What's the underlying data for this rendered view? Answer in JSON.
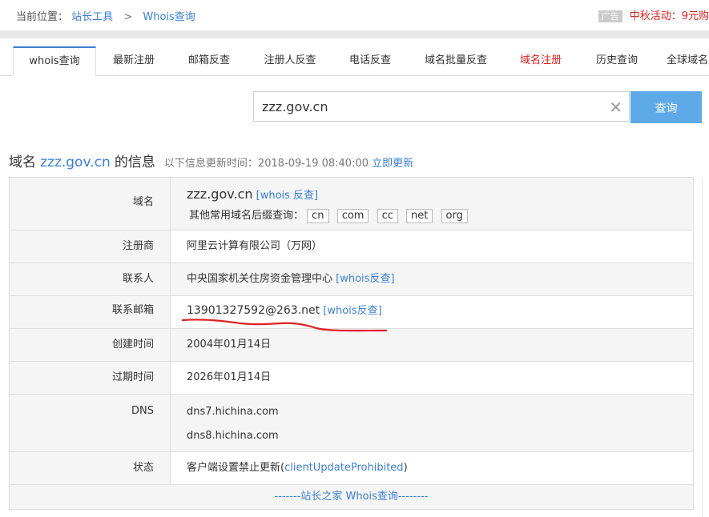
{
  "breadcrumb": {
    "prefix": "当前位置：",
    "items": [
      "站长工具",
      "Whois查询"
    ],
    "separator": ">"
  },
  "promo": {
    "ad_label": "广告",
    "text": "中秋活动：9元购"
  },
  "tabs": [
    {
      "label": "whois查询",
      "active": true
    },
    {
      "label": "最新注册"
    },
    {
      "label": "邮箱反查"
    },
    {
      "label": "注册人反查"
    },
    {
      "label": "电话反查"
    },
    {
      "label": "域名批量反查"
    },
    {
      "label": "域名注册",
      "highlight": true
    },
    {
      "label": "历史查询"
    },
    {
      "label": "全球域名"
    }
  ],
  "search": {
    "value": "zzz.gov.cn",
    "clear_icon": "close-icon",
    "button": "查询"
  },
  "heading": {
    "prefix": "域名",
    "domain": "zzz.gov.cn",
    "suffix": "的信息",
    "update_text": "以下信息更新时间：2018-09-19 08:40:00",
    "update_link": "立即更新"
  },
  "table": {
    "domain": {
      "label": "域名",
      "value": "zzz.gov.cn",
      "link": "[whois 反查]",
      "suffix_label": "其他常用域名后缀查询：",
      "suffixes": [
        "cn",
        "com",
        "cc",
        "net",
        "org"
      ]
    },
    "registrar": {
      "label": "注册商",
      "value": "阿里云计算有限公司（万网）"
    },
    "contact": {
      "label": "联系人",
      "value": "中央国家机关住房资金管理中心",
      "link": "[whois反查]"
    },
    "email": {
      "label": "联系邮箱",
      "value": "13901327592@263.net",
      "link": "[whois反查]"
    },
    "created": {
      "label": "创建时间",
      "value": "2004年01月14日"
    },
    "expires": {
      "label": "过期时间",
      "value": "2026年01月14日"
    },
    "dns": {
      "label": "DNS",
      "values": [
        "dns7.hichina.com",
        "dns8.hichina.com"
      ]
    },
    "status": {
      "label": "状态",
      "prefix": "客户端设置禁止更新(",
      "code": "clientUpdateProhibited",
      "suffix": ")"
    },
    "footer": "-------站长之家 Whois查询--------"
  },
  "colors": {
    "link": "#3a7fd5",
    "red": "#d9211e",
    "button": "#5ea9e8",
    "annotation": "#e02020"
  }
}
